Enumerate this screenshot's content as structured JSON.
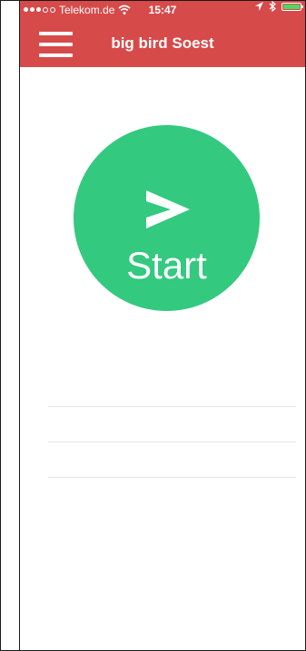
{
  "status_bar": {
    "carrier": "Telekom.de",
    "time": "15:47",
    "signal_dots": [
      true,
      true,
      true,
      false,
      false
    ],
    "battery_level": 1.0,
    "battery_color": "#4cd964"
  },
  "header": {
    "title": "big bird Soest",
    "background_color": "#d74a4a",
    "menu_icon": "hamburger-menu-icon"
  },
  "main": {
    "start_button": {
      "label": "Start",
      "icon": "chevron-right-icon",
      "color": "#33c97f"
    },
    "list_rows": [
      {
        "text": ""
      },
      {
        "text": ""
      },
      {
        "text": ""
      }
    ]
  }
}
